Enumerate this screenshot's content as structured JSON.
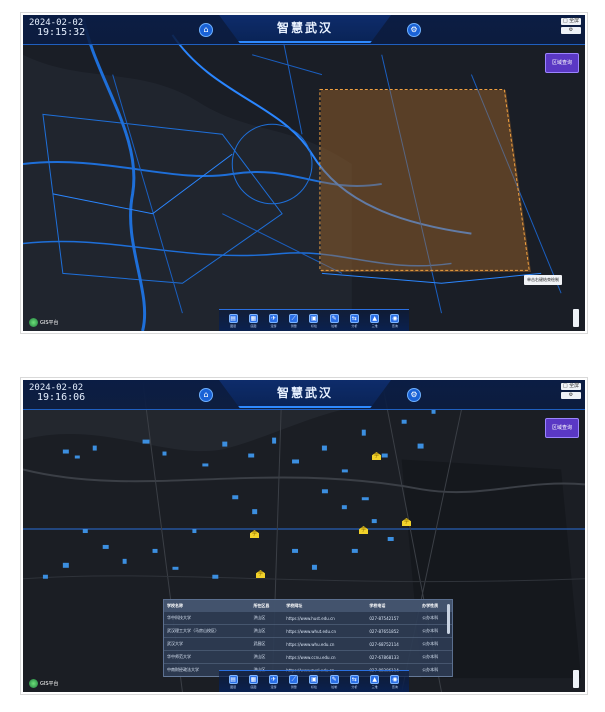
{
  "screens": [
    {
      "title": "智慧武汉",
      "date": "2024-02-02",
      "time": "19:15:32",
      "side_button": "区域查询",
      "tooltip": "单击右键结束绘制",
      "window_tools": [
        "□ 全屏",
        "⚙"
      ],
      "home_icon": "home-icon",
      "settings_icon": "gear-icon"
    },
    {
      "title": "智慧武汉",
      "date": "2024-02-02",
      "time": "19:16:06",
      "side_button": "区域查询",
      "window_tools": [
        "□ 全屏",
        "⚙"
      ],
      "table": {
        "headers": [
          "学校名称",
          "所在区县",
          "学校网址",
          "学校电话",
          "办学性质"
        ],
        "rows": [
          [
            "华中科技大学",
            "洪山区",
            "https://www.hust.edu.cn",
            "027-87542157",
            "公办本科"
          ],
          [
            "武汉理工大学（马房山校区）",
            "洪山区",
            "https://www.whut.edu.cn",
            "027-87651852",
            "公办本科"
          ],
          [
            "武汉大学",
            "武昌区",
            "https://www.whu.edu.cn",
            "027-68752114",
            "公办本科"
          ],
          [
            "华中师范大学",
            "洪山区",
            "https://www.ccnu.edu.cn",
            "027-67868133",
            "公办本科"
          ],
          [
            "中南财经政法大学",
            "洪山区",
            "https://www.zuel.edu.cn",
            "027-88386114",
            "公办本科"
          ]
        ]
      }
    }
  ],
  "toolbar": [
    "图层",
    "底图",
    "漫游",
    "测量",
    "标绘",
    "绘制",
    "分析",
    "三维",
    "查询"
  ],
  "logo_text": "GIS平台",
  "colors": {
    "accent": "#2f8bff",
    "selection": "#b06e28",
    "school_icon": "#f2d22a"
  }
}
